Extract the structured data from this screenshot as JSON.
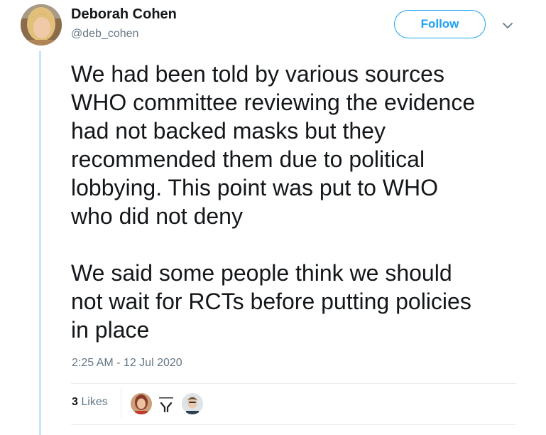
{
  "author": {
    "display_name": "Deborah Cohen",
    "handle": "@deb_cohen",
    "avatar": "user-avatar-photo"
  },
  "actions": {
    "follow_label": "Follow",
    "more_icon": "chevron-down-icon"
  },
  "tweet": {
    "paragraph1": [
      "We had been told by various sources",
      "WHO committee reviewing the evidence",
      "had not backed masks but they",
      "recommended them due to political",
      "lobbying. This point was put to WHO",
      "who did not deny"
    ],
    "paragraph2": [
      "We said some people think we should",
      "not wait for RCTs before putting policies",
      "in place"
    ],
    "timestamp": "2:25 AM - 12 Jul 2020"
  },
  "stats": {
    "likes_count": "3",
    "likes_label": "Likes"
  },
  "colors": {
    "accent": "#1da1f2",
    "thread_line": "#c4e6f7",
    "muted_text": "#657786"
  }
}
